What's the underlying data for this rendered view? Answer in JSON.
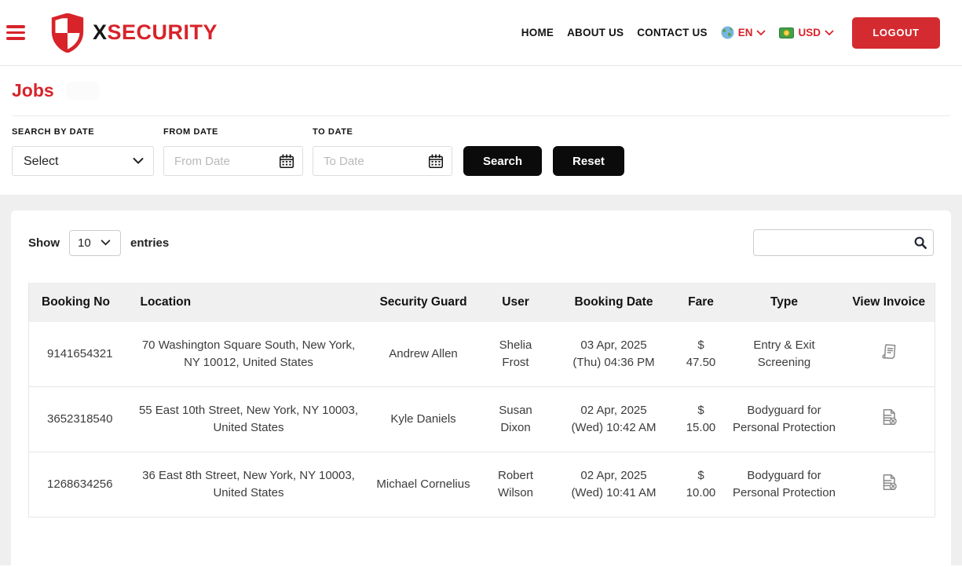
{
  "header": {
    "brand": {
      "x": "X",
      "rest": "SECURITY",
      "logo_icon": "shield-logo-icon"
    },
    "nav": {
      "home": "HOME",
      "about": "ABOUT US",
      "contact": "CONTACT US"
    },
    "language": {
      "label": "EN",
      "icon": "globe-icon"
    },
    "currency": {
      "label": "USD",
      "icon": "banknote-icon"
    },
    "logout_label": "LOGOUT",
    "menu_icon": "hamburger-menu-icon"
  },
  "page": {
    "title": "Jobs"
  },
  "filters": {
    "search_by_date": {
      "label": "SEARCH BY DATE",
      "selected": "Select"
    },
    "from_date": {
      "label": "FROM DATE",
      "placeholder": "From Date",
      "icon": "calendar-icon"
    },
    "to_date": {
      "label": "TO DATE",
      "placeholder": "To Date",
      "icon": "calendar-icon"
    },
    "search_label": "Search",
    "reset_label": "Reset"
  },
  "table": {
    "show_label": "Show",
    "entries_label": "entries",
    "page_size": "10",
    "search_icon": "search-icon",
    "columns": {
      "booking_no": "Booking No",
      "location": "Location",
      "guard": "Security Guard",
      "user": "User",
      "booking_date": "Booking Date",
      "fare": "Fare",
      "type": "Type",
      "view_invoice": "View Invoice"
    },
    "rows": [
      {
        "booking_no": "9141654321",
        "location": "70 Washington Square South, New York, NY 10012, United States",
        "guard": "Andrew Allen",
        "user": "Shelia Frost",
        "booking_date": "03 Apr, 2025\n(Thu) 04:36 PM",
        "fare": "$ 47.50",
        "type": "Entry & Exit Screening",
        "invoice_icon": "receipt-invoice-icon"
      },
      {
        "booking_no": "3652318540",
        "location": "55 East 10th Street, New York, NY 10003, United States",
        "guard": "Kyle Daniels",
        "user": "Susan Dixon",
        "booking_date": "02 Apr, 2025\n(Wed) 10:42 AM",
        "fare": "$ 15.00",
        "type": "Bodyguard for Personal Protection",
        "invoice_icon": "file-x-invoice-icon"
      },
      {
        "booking_no": "1268634256",
        "location": "36 East 8th Street, New York, NY 10003, United States",
        "guard": "Michael Cornelius",
        "user": "Robert Wilson",
        "booking_date": "02 Apr, 2025\n(Wed) 10:41 AM",
        "fare": "$ 10.00",
        "type": "Bodyguard for Personal Protection",
        "invoice_icon": "file-x-invoice-icon"
      }
    ]
  },
  "colors": {
    "accent_red": "#d8232a",
    "logout_red": "#d42b30",
    "button_dark": "#0b0b0b",
    "table_header_bg": "#f0f0f0",
    "page_gray": "#efeff0"
  }
}
